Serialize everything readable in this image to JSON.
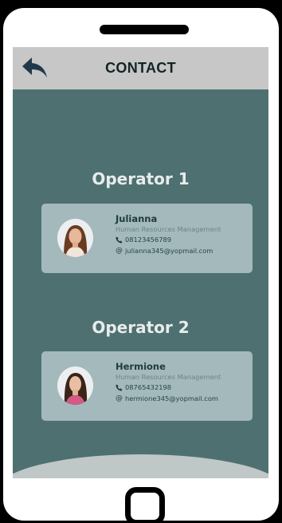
{
  "header": {
    "title": "CONTACT",
    "back_icon": "back-arrow-icon"
  },
  "operators": [
    {
      "section_title": "Operator 1",
      "name": "Julianna",
      "role": "Human Resources Management",
      "phone": "08123456789",
      "email": "julianna345@yopmail.com"
    },
    {
      "section_title": "Operator 2",
      "name": "Hermione",
      "role": "Human Resources Management",
      "phone": "08765432198",
      "email": "hermione345@yopmail.com"
    }
  ],
  "icons": {
    "phone": "phone-icon",
    "email": "at-icon",
    "home": "home-button-icon"
  },
  "colors": {
    "screen_bg": "#4f7070",
    "header_bg": "#c7c7c7",
    "card_bg": "#a3b9bb",
    "title_text": "#142424"
  }
}
